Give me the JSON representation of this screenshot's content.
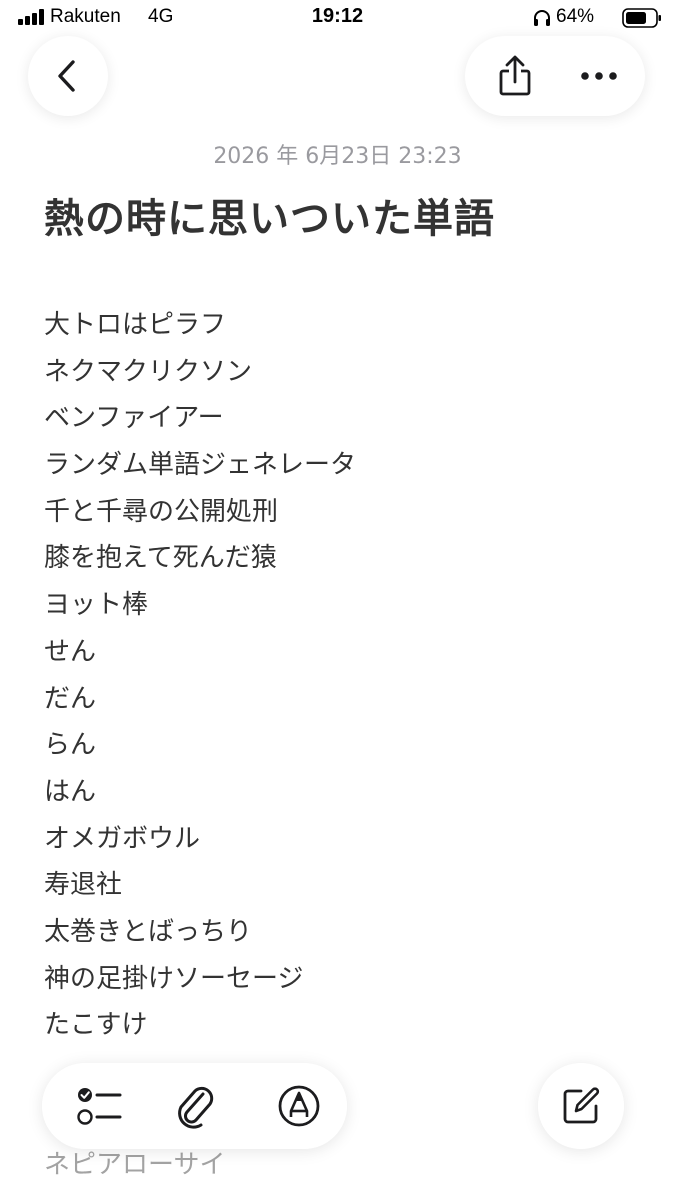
{
  "status_bar": {
    "carrier": "Rakuten",
    "network": "4G",
    "time": "19:12",
    "battery_percent": "64%",
    "icons": [
      "signal-icon",
      "headphones-icon",
      "battery-icon"
    ]
  },
  "nav": {
    "back_icon": "chevron-left-icon",
    "share_icon": "share-icon",
    "more_icon": "ellipsis-icon"
  },
  "note": {
    "date": "2026 年 6月23日 23:23",
    "title": "熱の時に思いついた単語",
    "lines": [
      "大トロはピラフ",
      "ネクマクリクソン",
      "ベンファイアー",
      "ランダム単語ジェネレータ",
      "千と千尋の公開処刑",
      "膝を抱えて死んだ猿",
      "ヨット棒",
      "せん",
      "だん",
      "らん",
      "はん",
      "オメガボウル",
      "寿退社",
      "太巻きとばっちり",
      "神の足掛けソーセージ",
      "たこすけ",
      "",
      "",
      "ネピアローサイ"
    ]
  },
  "toolbar": {
    "checklist_icon": "checklist-icon",
    "attachment_icon": "paperclip-icon",
    "markup_icon": "markup-pen-icon",
    "compose_icon": "compose-icon"
  }
}
